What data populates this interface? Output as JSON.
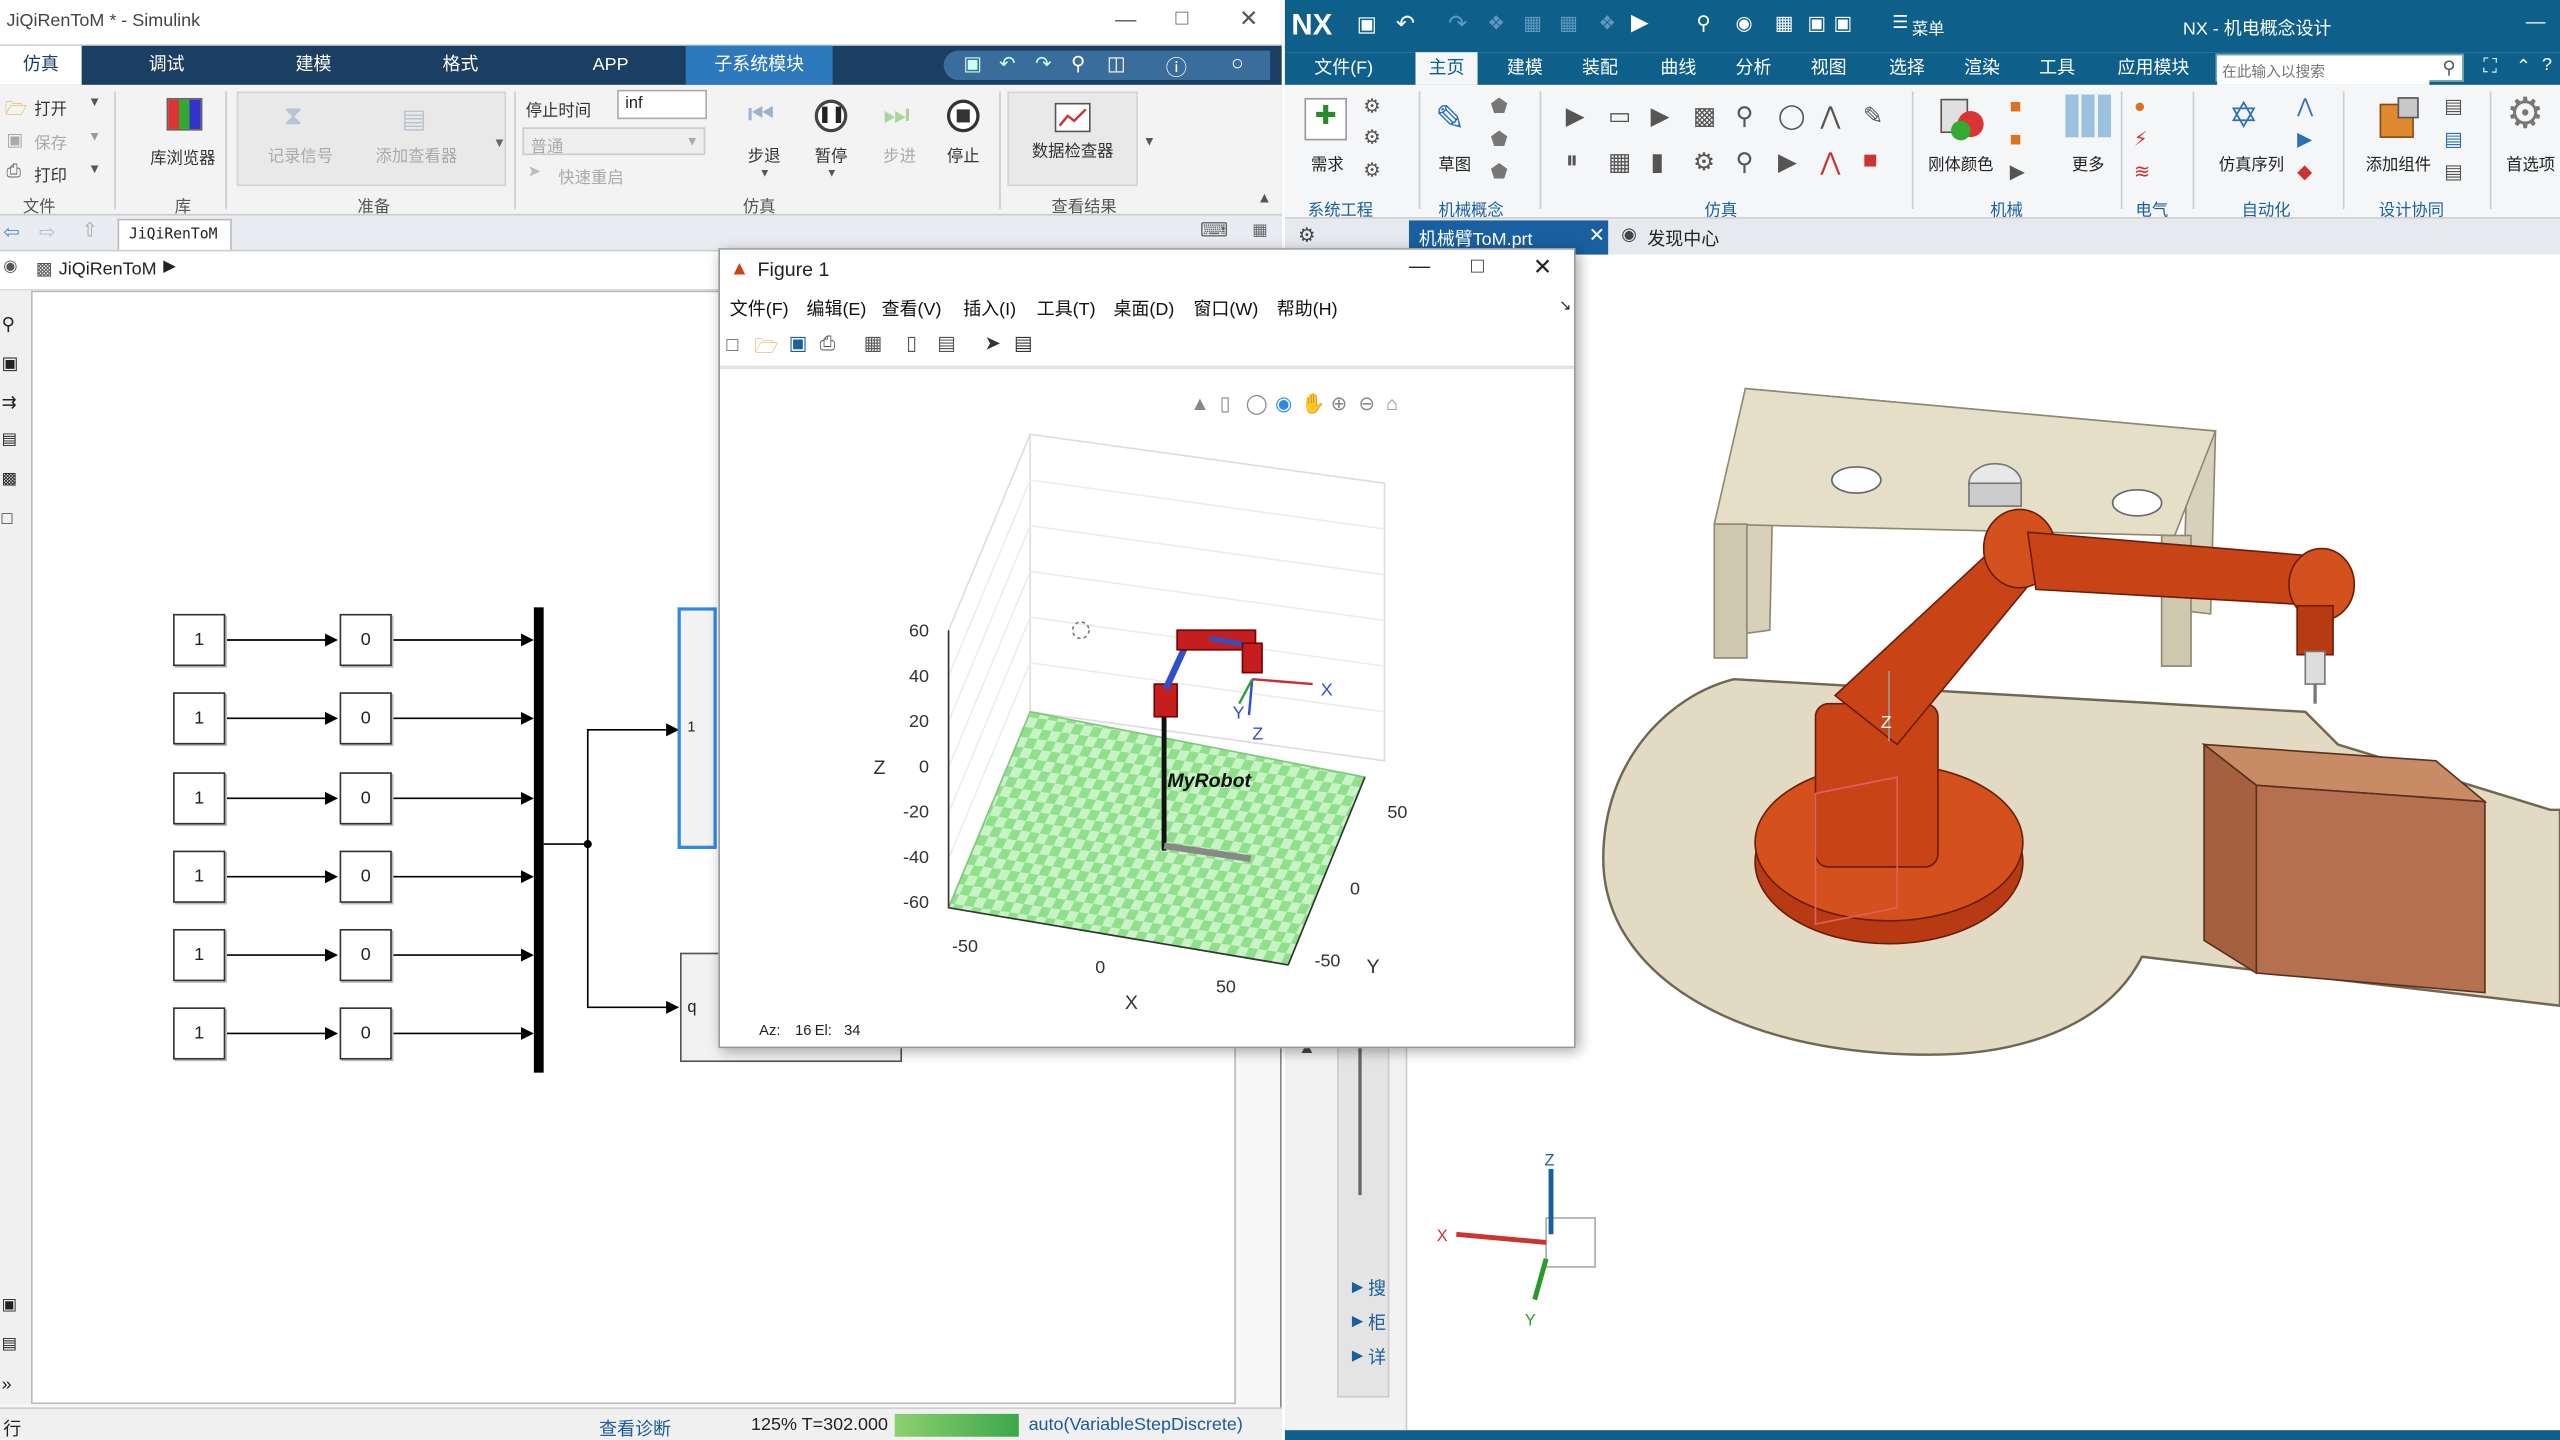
{
  "simulink": {
    "title": "JiQiRenToM * - Simulink",
    "tabs": [
      "仿真",
      "调试",
      "建模",
      "格式",
      "APP",
      "子系统模块"
    ],
    "file": {
      "open": "打开",
      "save": "保存",
      "print": "打印",
      "section": "文件"
    },
    "library": {
      "browser": "库浏览器",
      "section": "库"
    },
    "prepare": {
      "record": "记录信号",
      "add_viewer": "添加查看器",
      "section": "准备"
    },
    "sim": {
      "stop_time_label": "停止时间",
      "stop_time_value": "inf",
      "mode": "普通",
      "fast_restart": "快速重启",
      "step_back": "步退",
      "pause": "暂停",
      "step_forward": "步进",
      "stop": "停止",
      "section": "仿真"
    },
    "results": {
      "data_inspector": "数据检查器",
      "section": "查看结果"
    },
    "tab_label": "JiQiRenToM",
    "breadcrumb": "JiQiRenToM",
    "constants": [
      "1",
      "1",
      "1",
      "1",
      "1",
      "1"
    ],
    "gains": [
      "0",
      "0",
      "0",
      "0",
      "0",
      "0"
    ],
    "port_labels": [
      "1",
      "q"
    ],
    "status": {
      "diagnostics": "查看诊断",
      "zoom": "125%",
      "time": "T=302.000",
      "solver": "auto(VariableStepDiscrete)"
    },
    "left_bottom_label": "行"
  },
  "figure": {
    "title": "Figure 1",
    "menu": [
      "文件(F)",
      "编辑(E)",
      "查看(V)",
      "插入(I)",
      "工具(T)",
      "桌面(D)",
      "窗口(W)",
      "帮助(H)"
    ],
    "zlabel": "Z",
    "xlabel": "X",
    "ylabel": "Y",
    "zticks": [
      "60",
      "40",
      "20",
      "0",
      "-20",
      "-40",
      "-60"
    ],
    "xticks": [
      "-50",
      "0",
      "50"
    ],
    "yticks": [
      "50",
      "0",
      "-50"
    ],
    "robot_label": "MyRobot",
    "frame_labels": {
      "x": "X",
      "y": "Y",
      "z": "Z"
    },
    "view_readout": {
      "az_label": "Az:",
      "az": "16",
      "el_label": "El:",
      "el": "34"
    }
  },
  "nx": {
    "logo": "NX",
    "quick_menu": "菜单",
    "title": "NX - 机电概念设计",
    "menu": [
      "文件(F)",
      "主页",
      "建模",
      "装配",
      "曲线",
      "分析",
      "视图",
      "选择",
      "渲染",
      "工具",
      "应用模块"
    ],
    "search_placeholder": "在此输入以搜索",
    "ribbon": {
      "requirements": "需求",
      "sketch": "草图",
      "rigid_color": "刚体颜色",
      "more": "更多",
      "sim_sequence": "仿真序列",
      "add_component": "添加组件",
      "preferences": "首选项"
    },
    "sections": [
      "系统工程",
      "机械概念",
      "仿真",
      "机械",
      "电气",
      "自动化",
      "设计协同"
    ],
    "doc_tab": "机械臂ToM.prt",
    "discovery_tab": "发现中心",
    "side_items": [
      "搜",
      "柜",
      "详"
    ],
    "triad": {
      "x": "X",
      "y": "Y",
      "z": "Z"
    },
    "model_axis": "Z"
  },
  "colors": {
    "simulink_tab_bg": "#1a3f63",
    "simulink_active_tab": "#2e79bd",
    "nx_bar": "#0e5f8a",
    "robot": "#c84416",
    "floor_green": "#8ee08a",
    "plate": "#ddd5bf",
    "box": "#b5714f"
  }
}
